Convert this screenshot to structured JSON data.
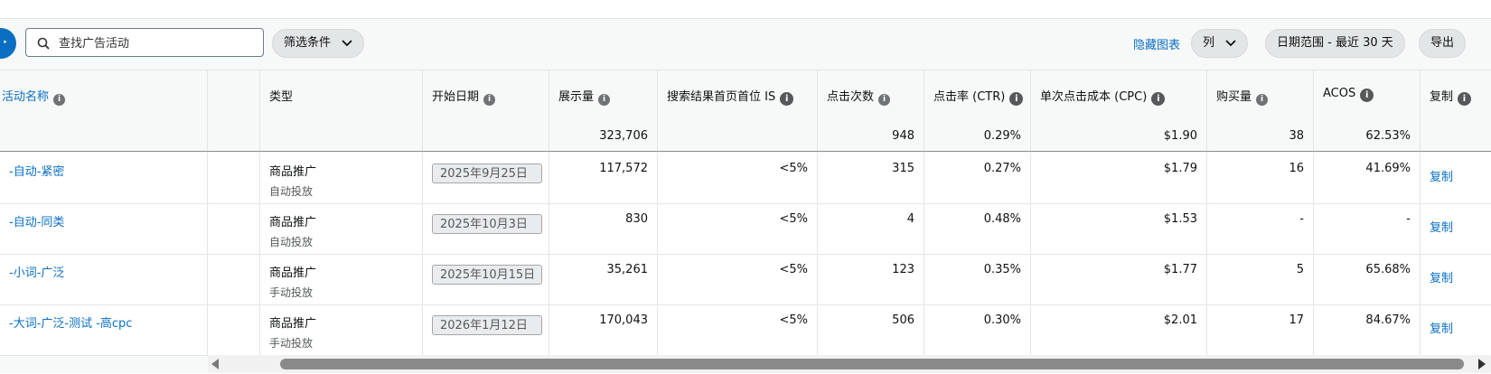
{
  "toolbar": {
    "search_placeholder": "查找广告活动",
    "filter_label": "筛选条件",
    "hide_chart_label": "隐藏图表",
    "columns_label": "列",
    "date_range_label": "日期范围 - 最近 30 天",
    "export_label": "导出"
  },
  "columns": {
    "name": "活动名称",
    "type": "类型",
    "start_date": "开始日期",
    "impressions": "展示量",
    "top_is": "搜索结果首页首位 IS",
    "clicks": "点击次数",
    "ctr": "点击率 (CTR)",
    "cpc": "单次点击成本 (CPC)",
    "purchases": "购买量",
    "acos": "ACOS",
    "copy": "复制"
  },
  "summary": {
    "impressions": "323,706",
    "clicks": "948",
    "ctr": "0.29%",
    "cpc": "$1.90",
    "purchases": "38",
    "acos": "62.53%"
  },
  "rows": [
    {
      "name": "-自动-紧密",
      "type": "商品推广",
      "targeting": "自动投放",
      "start_date": "2025年9月25日",
      "impressions": "117,572",
      "top_is": "<5%",
      "clicks": "315",
      "ctr": "0.27%",
      "cpc": "$1.79",
      "purchases": "16",
      "acos": "41.69%",
      "copy": "复制"
    },
    {
      "name": "-自动-同类",
      "type": "商品推广",
      "targeting": "自动投放",
      "start_date": "2025年10月3日",
      "impressions": "830",
      "top_is": "<5%",
      "clicks": "4",
      "ctr": "0.48%",
      "cpc": "$1.53",
      "purchases": "-",
      "acos": "-",
      "copy": "复制"
    },
    {
      "name": "-小词-广泛",
      "type": "商品推广",
      "targeting": "手动投放",
      "start_date": "2025年10月15日",
      "impressions": "35,261",
      "top_is": "<5%",
      "clicks": "123",
      "ctr": "0.35%",
      "cpc": "$1.77",
      "purchases": "5",
      "acos": "65.68%",
      "copy": "复制"
    },
    {
      "name": "-大词-广泛-测试 -高cpc",
      "type": "商品推广",
      "targeting": "手动投放",
      "start_date": "2026年1月12日",
      "impressions": "170,043",
      "top_is": "<5%",
      "clicks": "506",
      "ctr": "0.30%",
      "cpc": "$2.01",
      "purchases": "17",
      "acos": "84.67%",
      "copy": "复制"
    }
  ],
  "colors": {
    "accent": "#0a6fc2",
    "link": "#0a6fc2",
    "pill_bg": "#e3e6e6"
  },
  "icons": {
    "search": "search-icon",
    "info": "info-icon",
    "chevron": "chevron-down-icon"
  }
}
